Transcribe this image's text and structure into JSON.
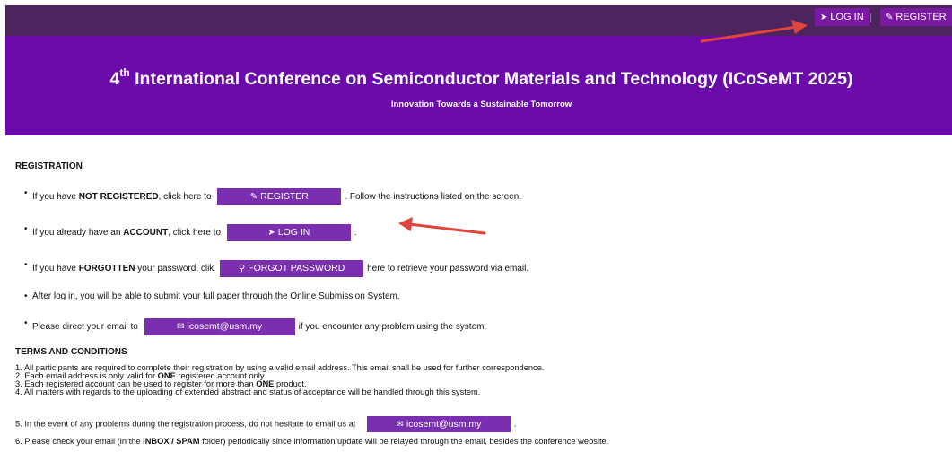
{
  "header": {
    "login_label": "LOG IN",
    "register_label": "REGISTER",
    "title_prefix": "4",
    "title_sup": "th",
    "title_rest": " International Conference on Semiconductor Materials and Technology (ICoSeMT 2025)",
    "subtitle": "Innovation Towards a Sustainable Tomorrow"
  },
  "registration": {
    "heading": "REGISTRATION",
    "b1_pre": "If you have ",
    "b1_bold": "NOT REGISTERED",
    "b1_mid": ", click here to",
    "b1_btn": "REGISTER",
    "b1_post": ". Follow the instructions listed on the screen.",
    "b2_pre": "If you already have an ",
    "b2_bold": "ACCOUNT",
    "b2_mid": ", click here to",
    "b2_btn": "LOG IN",
    "b2_post": ".",
    "b3_pre": "If you have ",
    "b3_bold": "FORGOTTEN",
    "b3_mid": " your password, clik",
    "b3_btn": "FORGOT PASSWORD",
    "b3_post": "here to retrieve your password via email.",
    "b4": "After log in, you will be able to submit your full paper through the Online Submission System.",
    "b5_pre": "Please direct your email to",
    "b5_btn": "icosemt@usm.my",
    "b5_post": "if you encounter any problem using the system."
  },
  "terms": {
    "heading": "TERMS AND CONDITIONS",
    "t1": "1. All participants are required to complete their registration by using a valid email address. This email shall be used for further correspondence.",
    "t2_pre": "2. Each email address is only valid for ",
    "t2_bold": "ONE",
    "t2_post": " registered account only.",
    "t3_pre": "3. Each registered account can be used to register for more than ",
    "t3_bold": "ONE",
    "t3_post": " product.",
    "t4": "4. All matters with regards to the uploading of extended abstract and status of acceptance will be handled through this system.",
    "t5_pre": "5. In the event of any problems during the registration process, do not hesitate to email us at",
    "t5_btn": "icosemt@usm.my",
    "t5_post": ".",
    "t6_pre": "6. Please check your email (in the ",
    "t6_bold": "INBOX / SPAM",
    "t6_post": " folder) periodically since information update will be relayed through the email, besides the conference website."
  },
  "colors": {
    "banner": "#6a0aa8",
    "topbar": "#4d245e",
    "button": "#7a2fb0",
    "arrow": "#e0443a"
  },
  "icons": {
    "login": "sign-in-icon",
    "register": "edit-icon",
    "forgot": "key-icon",
    "email": "envelope-icon"
  }
}
